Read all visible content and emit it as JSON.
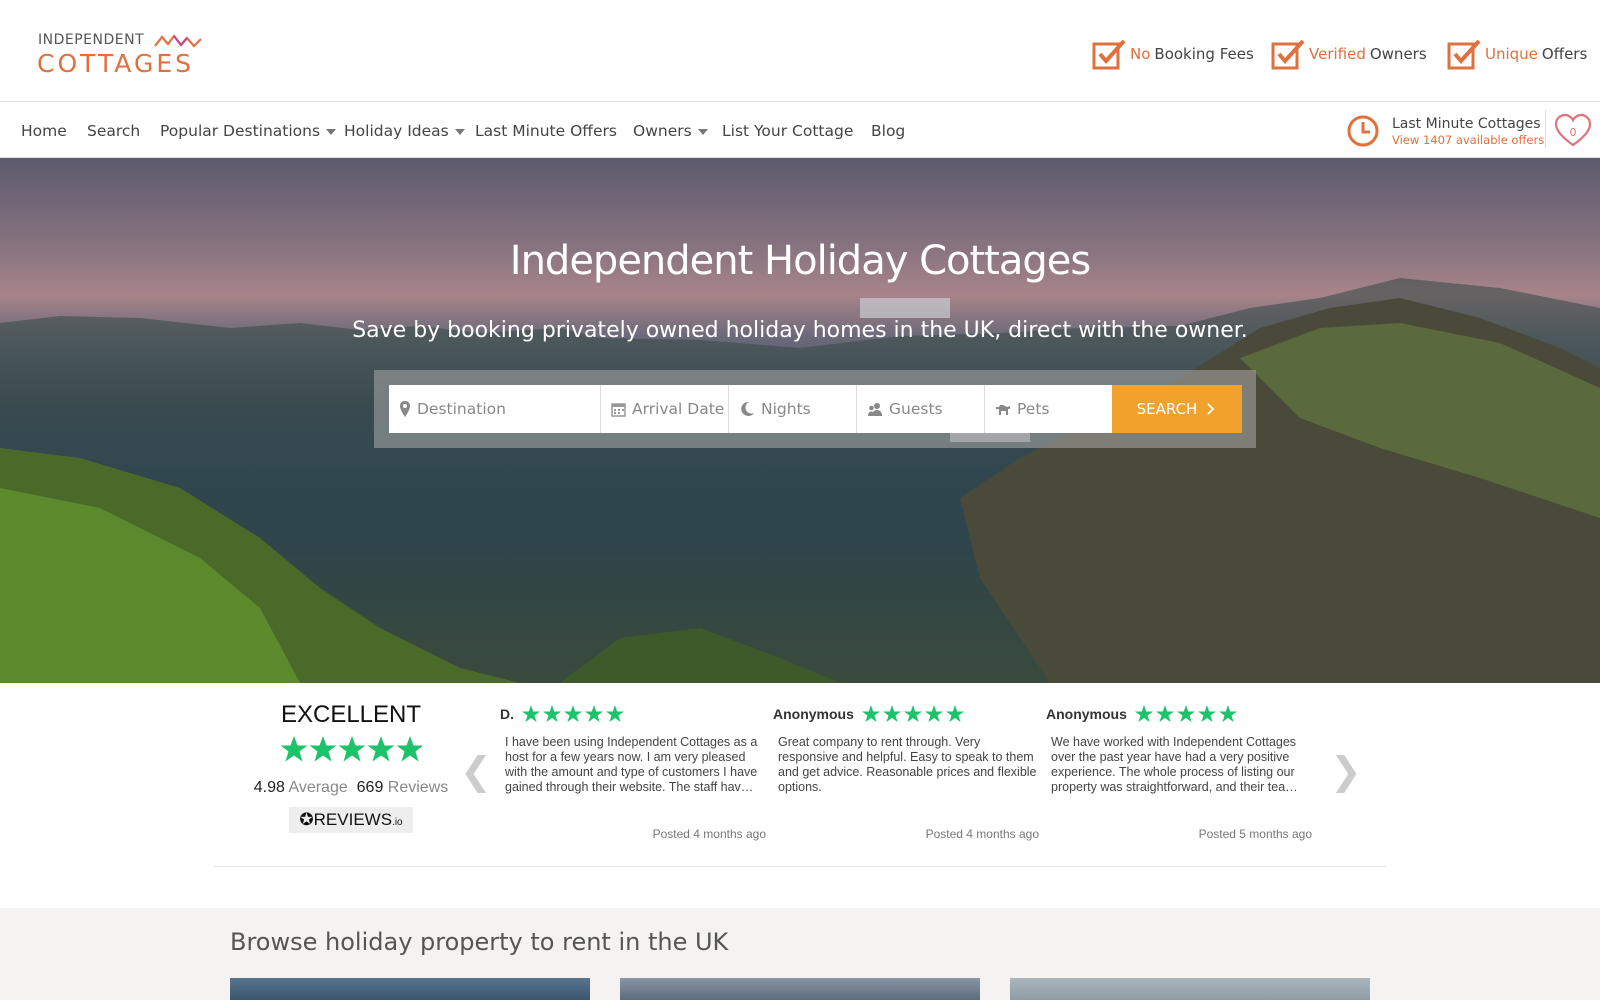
{
  "logo": {
    "top": "INDEPENDENT",
    "main": "COTTAGES"
  },
  "usps": [
    {
      "highlight": "No",
      "text": "Booking Fees"
    },
    {
      "highlight": "Verified",
      "text": "Owners"
    },
    {
      "highlight": "Unique",
      "text": "Offers"
    }
  ],
  "nav": {
    "items": [
      "Home",
      "Search",
      "Popular Destinations",
      "Holiday Ideas",
      "Last Minute Offers",
      "Owners",
      "List Your Cottage",
      "Blog"
    ],
    "last_minute_title": "Last Minute Cottages",
    "last_minute_sub": "View 1407 available offers",
    "favourites_count": "0"
  },
  "hero": {
    "title": "Independent Holiday Cottages",
    "subtitle": "Save by booking privately owned holiday homes in the UK, direct with the owner.",
    "search": {
      "destination_placeholder": "Destination",
      "arrival_placeholder": "Arrival Date",
      "nights_placeholder": "Nights",
      "guests_placeholder": "Guests",
      "pets_placeholder": "Pets",
      "button": "SEARCH"
    }
  },
  "reviews": {
    "rating_word": "EXCELLENT",
    "average": "4.98",
    "average_label": "Average",
    "count": "669",
    "count_label": "Reviews",
    "provider": "REVIEWS",
    "provider_suffix": ".io",
    "cards": [
      {
        "name": "D.",
        "text": "I have been using Independent Cottages as a host for a few years now. I am very pleased with the amount and type of customers I have gained through their website. The staff hav…",
        "posted": "Posted 4 months ago"
      },
      {
        "name": "Anonymous",
        "text": "Great company to rent through. Very responsive and helpful. Easy to speak to them and get advice. Reasonable prices and flexible options.",
        "posted": "Posted 4 months ago"
      },
      {
        "name": "Anonymous",
        "text": "We have worked with Independent Cottages over the past year have had a very positive experience. The whole process of listing our property was straightforward, and their tea…",
        "posted": "Posted 5 months ago"
      }
    ],
    "star_color": "#1cc36b"
  },
  "browse": {
    "title": "Browse holiday property to rent in the UK"
  },
  "colors": {
    "accent": "#e0703c",
    "search_button": "#f0a22d"
  }
}
